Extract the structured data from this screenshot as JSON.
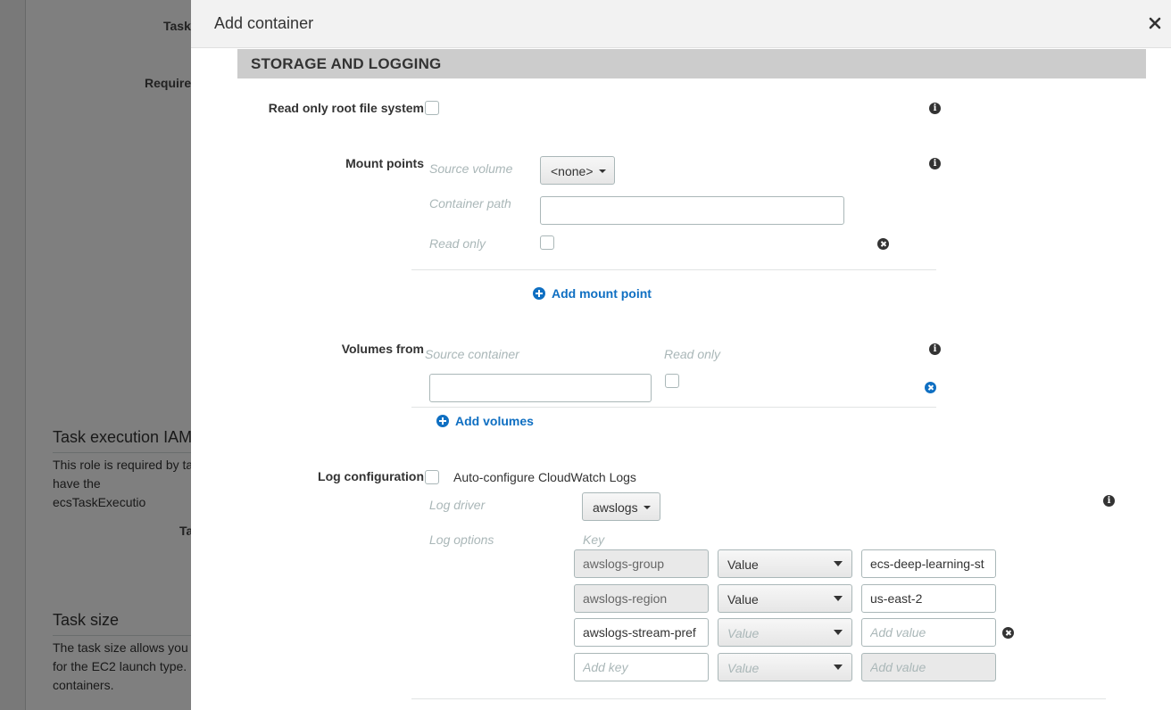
{
  "background": {
    "task_label": "Task",
    "requires_label": "Require",
    "task_execution_heading": "Task execution IAM",
    "task_execution_desc": "This role is required by ta have the ecsTaskExecutio",
    "ta_label": "Ta",
    "task_size_heading": "Task size",
    "task_size_desc": "The task size allows you for the EC2 launch type. containers."
  },
  "modal": {
    "title": "Add container",
    "section_title": "STORAGE AND LOGGING",
    "read_only_root": {
      "label": "Read only root file system",
      "checked": false
    },
    "mount_points": {
      "label": "Mount points",
      "source_volume_hint": "Source volume",
      "source_volume_value": "<none>",
      "container_path_hint": "Container path",
      "container_path_value": "",
      "read_only_hint": "Read only",
      "add_link": "Add mount point"
    },
    "volumes_from": {
      "label": "Volumes from",
      "source_container_hint": "Source container",
      "read_only_hint": "Read only",
      "source_container_value": "",
      "add_link": "Add volumes"
    },
    "log_configuration": {
      "label": "Log configuration",
      "auto_configure_label": "Auto-configure CloudWatch Logs",
      "log_driver_hint": "Log driver",
      "log_driver_value": "awslogs",
      "log_options_hint": "Log options",
      "key_hint": "Key",
      "options": [
        {
          "key": "awslogs-group",
          "type": "Value",
          "value": "ecs-deep-learning-st"
        },
        {
          "key": "awslogs-region",
          "type": "Value",
          "value": "us-east-2"
        },
        {
          "key": "awslogs-stream-pref",
          "type": "Value",
          "value": "",
          "value_placeholder": "Add value"
        },
        {
          "key": "",
          "key_placeholder": "Add key",
          "type": "Value",
          "value": "",
          "value_placeholder": "Add value"
        }
      ]
    }
  },
  "icons": {
    "info": "info-icon",
    "remove": "remove-icon",
    "add": "plus-circle-icon",
    "close": "close-icon"
  },
  "colors": {
    "link": "#0f6fc2",
    "section_bar": "#cccccc",
    "header_bg": "#f2f2f2",
    "overlay": "rgba(0,0,0,0.5)"
  }
}
